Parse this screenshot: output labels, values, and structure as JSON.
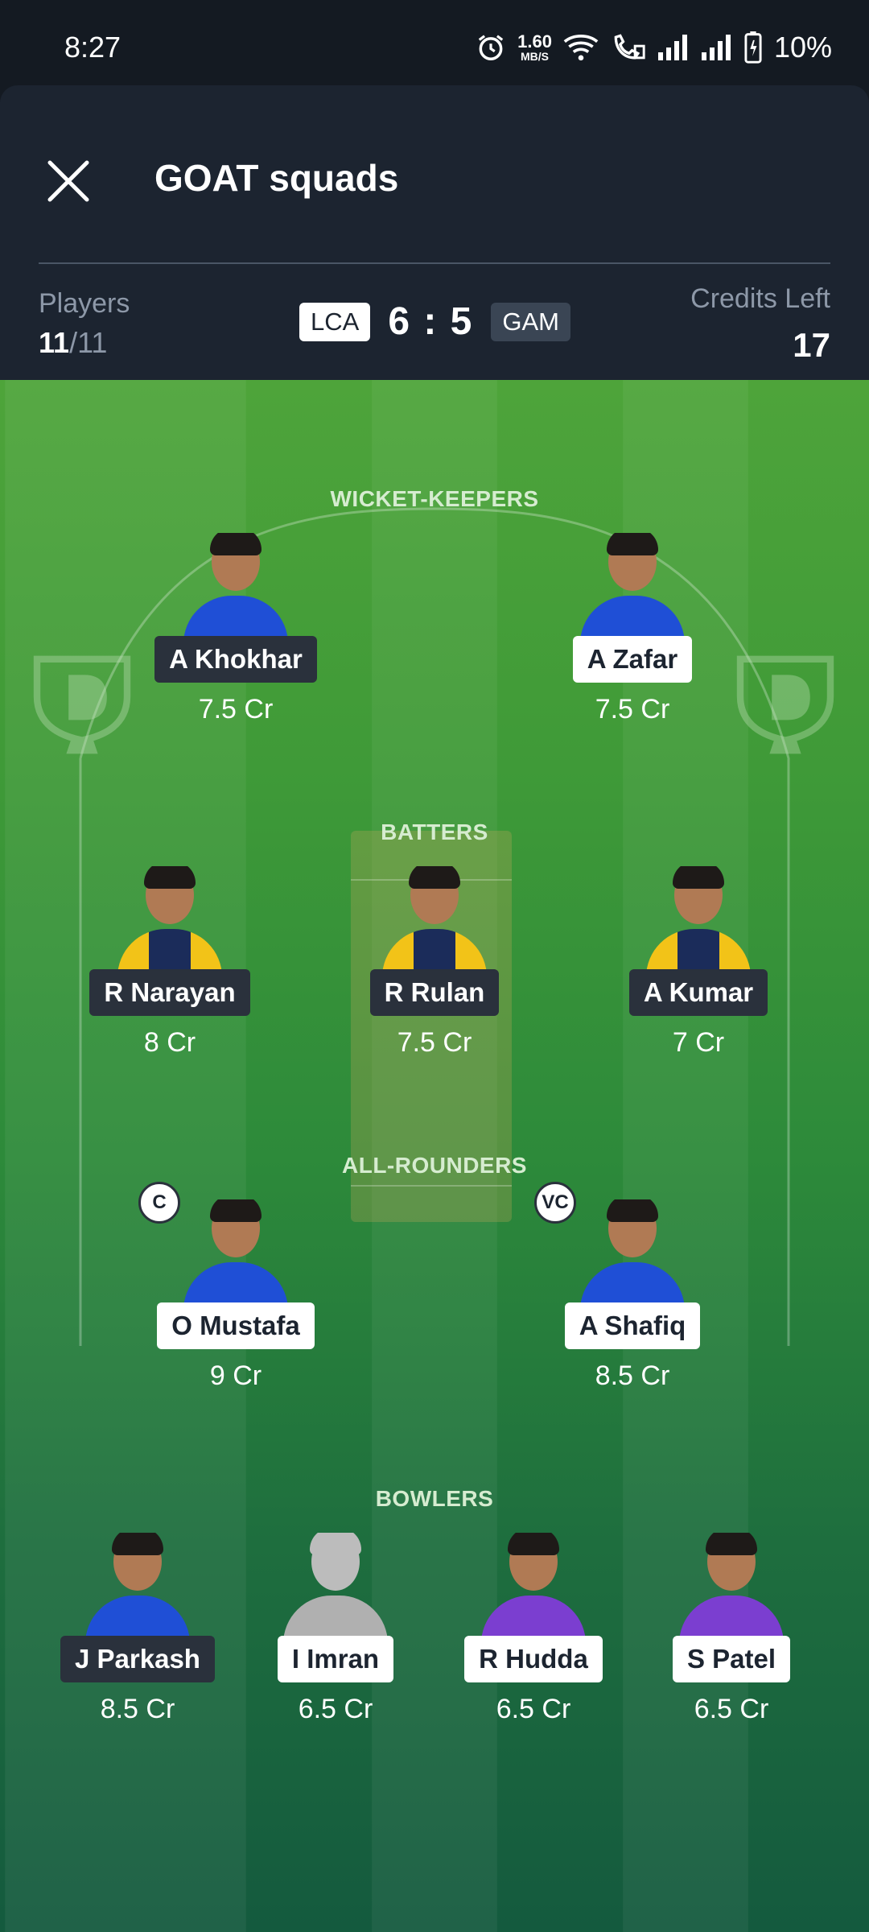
{
  "status_bar": {
    "time": "8:27",
    "speed_value": "1.60",
    "speed_unit": "MB/S",
    "battery": "10%",
    "icons": [
      "alarm-icon",
      "wifi-icon",
      "wifi-calling-icon",
      "signal-icon",
      "signal-icon",
      "battery-charging-icon"
    ]
  },
  "header": {
    "title": "GOAT squads",
    "close_icon": "close-icon",
    "players_label": "Players",
    "players_selected": "11",
    "players_total": "/11",
    "team_left": "LCA",
    "team_right": "GAM",
    "score": "6 : 5",
    "credits_label": "Credits Left",
    "credits_value": "17"
  },
  "sections": {
    "wicket_keepers": "WICKET-KEEPERS",
    "batters": "BATTERS",
    "all_rounders": "ALL-ROUNDERS",
    "bowlers": "BOWLERS"
  },
  "players": {
    "wk": [
      {
        "name": "A Khokhar",
        "credits": "7.5 Cr",
        "team": "dark",
        "kit": "blue"
      },
      {
        "name": "A Zafar",
        "credits": "7.5 Cr",
        "team": "light",
        "kit": "blue"
      }
    ],
    "bat": [
      {
        "name": "R Narayan",
        "credits": "8 Cr",
        "team": "dark",
        "kit": "yellow"
      },
      {
        "name": "R Rulan",
        "credits": "7.5 Cr",
        "team": "dark",
        "kit": "yellow"
      },
      {
        "name": "A Kumar",
        "credits": "7 Cr",
        "team": "dark",
        "kit": "yellow"
      }
    ],
    "ar": [
      {
        "name": "O Mustafa",
        "credits": "9 Cr",
        "team": "light",
        "kit": "blue",
        "badge": "C"
      },
      {
        "name": "A Shafiq",
        "credits": "8.5 Cr",
        "team": "light",
        "kit": "blue",
        "badge": "VC"
      }
    ],
    "bowl": [
      {
        "name": "J Parkash",
        "credits": "8.5 Cr",
        "team": "dark",
        "kit": "blue"
      },
      {
        "name": "I Imran",
        "credits": "6.5 Cr",
        "team": "light",
        "kit": "ghost"
      },
      {
        "name": "R Hudda",
        "credits": "6.5 Cr",
        "team": "light",
        "kit": "purple"
      },
      {
        "name": "S Patel",
        "credits": "6.5 Cr",
        "team": "light",
        "kit": "purple"
      }
    ]
  },
  "colors": {
    "header_bg": "#1c2430",
    "field_top": "#4ea43a",
    "field_bottom": "#145a3e",
    "tag_dark": "#2a313c",
    "tag_light": "#ffffff"
  }
}
